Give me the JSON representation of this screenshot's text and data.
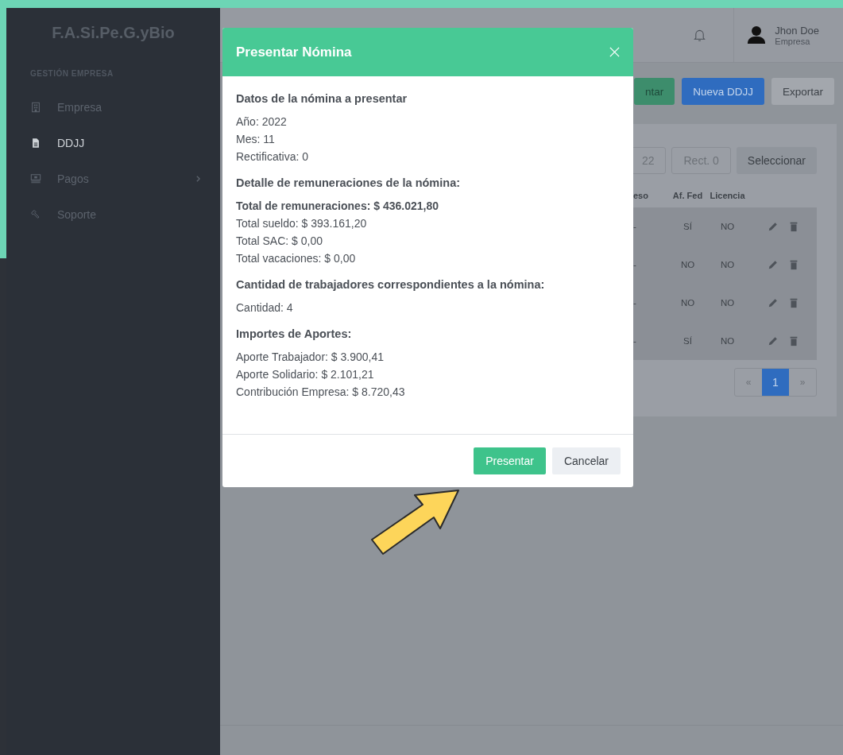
{
  "sidebar": {
    "brand": "F.A.Si.Pe.G.yBio",
    "section": "GESTIÓN EMPRESA",
    "items": [
      {
        "label": "Empresa",
        "kind": "building",
        "selected": false,
        "has_submenu": false
      },
      {
        "label": "DDJJ",
        "kind": "document",
        "selected": true,
        "has_submenu": false
      },
      {
        "label": "Pagos",
        "kind": "money",
        "selected": false,
        "has_submenu": true
      },
      {
        "label": "Soporte",
        "kind": "tools",
        "selected": false,
        "has_submenu": false
      }
    ]
  },
  "header": {
    "user_name": "Jhon Doe",
    "user_role": "Empresa"
  },
  "toolbar": [
    {
      "label": "ntar",
      "kind": "success"
    },
    {
      "label": "Nueva DDJJ",
      "kind": "primary"
    },
    {
      "label": "Exportar",
      "kind": "secondary"
    }
  ],
  "filters": {
    "field_1": "22",
    "field_2": "Rect. 0",
    "button": "Seleccionar"
  },
  "table": {
    "columns": [
      "eso",
      "Af. Fed",
      "Licencia"
    ],
    "rows": [
      {
        "cells": [
          "-",
          "SÍ",
          "NO"
        ]
      },
      {
        "cells": [
          "-",
          "NO",
          "NO"
        ]
      },
      {
        "cells": [
          "-",
          "NO",
          "NO"
        ]
      },
      {
        "cells": [
          "-",
          "SÍ",
          "NO"
        ]
      }
    ]
  },
  "pagination": {
    "prev": "«",
    "pages": [
      {
        "label": "1",
        "selected": true
      }
    ],
    "next": "»"
  },
  "modal": {
    "title": "Presentar Nómina",
    "sections": [
      {
        "heading": "Datos de la nómina a presentar",
        "lines": [
          {
            "text": "Año: 2022",
            "bold": false
          },
          {
            "text": "Mes: 11",
            "bold": false
          },
          {
            "text": "Rectificativa: 0",
            "bold": false
          }
        ]
      },
      {
        "heading": "Detalle de remuneraciones de la nómina:",
        "lines": [
          {
            "text": "Total de remuneraciones: $ 436.021,80",
            "bold": true
          },
          {
            "text": "Total sueldo: $ 393.161,20",
            "bold": false
          },
          {
            "text": "Total SAC: $ 0,00",
            "bold": false
          },
          {
            "text": "Total vacaciones: $ 0,00",
            "bold": false
          }
        ]
      },
      {
        "heading": "Cantidad de trabajadores correspondientes a la nómina:",
        "lines": [
          {
            "text": "Cantidad: 4",
            "bold": false
          }
        ]
      },
      {
        "heading": "Importes de Aportes:",
        "lines": [
          {
            "text": "Aporte Trabajador: $ 3.900,41",
            "bold": false
          },
          {
            "text": "Aporte Solidario: $ 2.101,21",
            "bold": false
          },
          {
            "text": "Contribución Empresa: $ 8.720,43",
            "bold": false
          }
        ]
      }
    ],
    "buttons": [
      {
        "label": "Presentar",
        "kind": "primary"
      },
      {
        "label": "Cancelar",
        "kind": "secondary"
      }
    ]
  }
}
